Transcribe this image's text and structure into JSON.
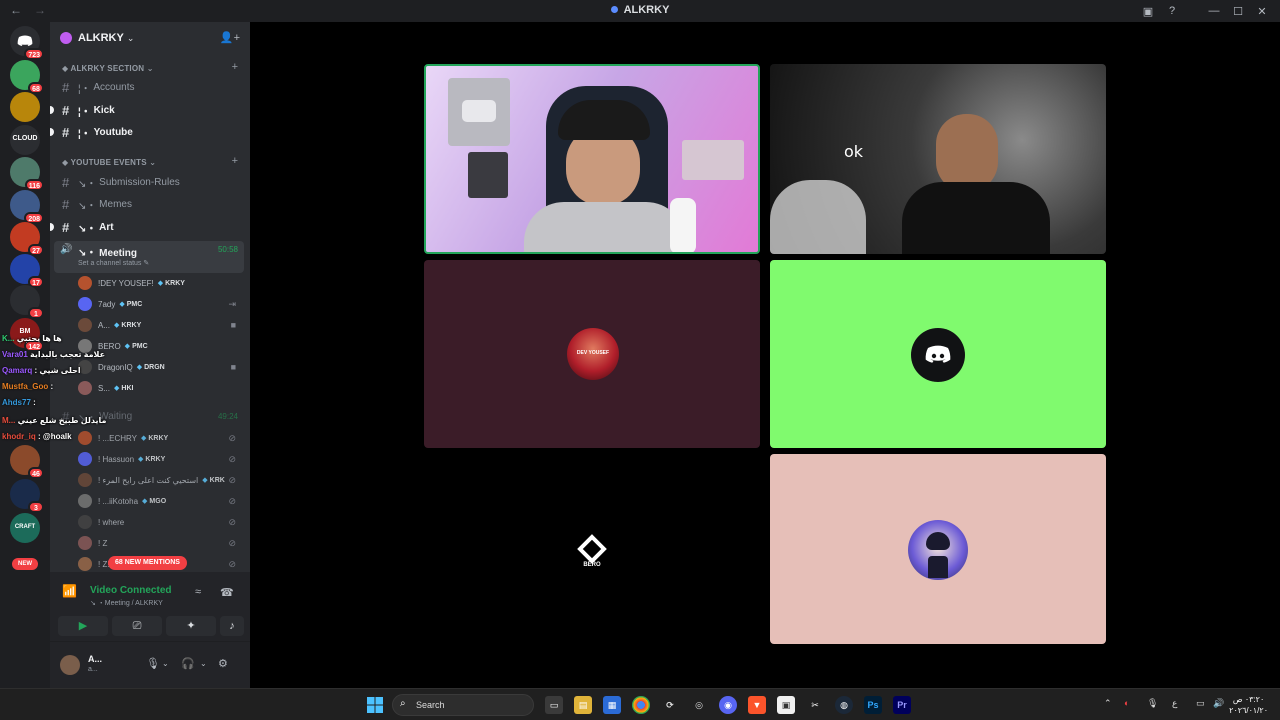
{
  "window": {
    "title": "ALKRKY",
    "back": "←",
    "forward": "→",
    "minimize": "—",
    "maximize": "☐",
    "close": "✕",
    "help": "?",
    "inbox": "▣"
  },
  "rail": {
    "home_badge": "723",
    "servers": [
      {
        "label": "",
        "badge": "68",
        "color": "#3ba55d"
      },
      {
        "label": "",
        "badge": "",
        "color": "#b8860b"
      },
      {
        "label": "CLOUD",
        "badge": "",
        "color": "#2b2d31"
      },
      {
        "label": "",
        "badge": "116",
        "color": "#4e7a6a"
      },
      {
        "label": "",
        "badge": "208",
        "color": "#3e5a8a"
      },
      {
        "label": "",
        "badge": "27",
        "color": "#c23b22"
      },
      {
        "label": "",
        "badge": "17",
        "color": "#2343a8"
      },
      {
        "label": "",
        "badge": "1",
        "color": "#2b2d31"
      },
      {
        "label": "BM",
        "badge": "142",
        "color": "#8a1a1a"
      }
    ],
    "servers_lower": [
      {
        "label": "",
        "badge": "46",
        "color": "#8b4a2b"
      },
      {
        "label": "",
        "badge": "3",
        "color": "#1a2b4a"
      },
      {
        "label": "CRAFT",
        "badge": "",
        "color": "#1c6b5a"
      }
    ],
    "new_label": "NEW"
  },
  "sidebar": {
    "server_name": "ALKRKY",
    "categories": [
      {
        "name": "ALKRKY SECTION"
      },
      {
        "name": "YOUTUBE EVENTS"
      }
    ],
    "channels": [
      {
        "name": "Accounts",
        "prefix": "¦・"
      },
      {
        "name": "Kick",
        "prefix": "¦・"
      },
      {
        "name": "Youtube",
        "prefix": "¦・"
      },
      {
        "name": "Submission-Rules",
        "prefix": "↘・"
      },
      {
        "name": "Memes",
        "prefix": "↘・"
      },
      {
        "name": "Art",
        "prefix": "↘・"
      }
    ],
    "voice_channel": {
      "name": "Meeting",
      "prefix": "↘・",
      "timer": "50:58",
      "status": "Set a channel status ✎"
    },
    "voice_users": [
      {
        "name": "!DEY YOUSEF!",
        "tag": "KRKY",
        "state": ""
      },
      {
        "name": "7ady",
        "tag": "PMC",
        "state": "⇥"
      },
      {
        "name": "A...",
        "tag": "KRKY",
        "state": "■"
      },
      {
        "name": "BERO",
        "tag": "PMC",
        "state": ""
      },
      {
        "name": "DragonIQ",
        "tag": "DRGN",
        "state": "■"
      },
      {
        "name": "S...",
        "tag": "HKI",
        "state": ""
      }
    ],
    "waiting_channel": {
      "name": "Waiting",
      "prefix": "↘・",
      "timer": "49:24"
    },
    "waiting_users": [
      {
        "name": "! ...ECHRY",
        "tag": "KRKY",
        "state": "⊘"
      },
      {
        "name": "! Hassuon",
        "tag": "KRKY",
        "state": "⊘"
      },
      {
        "name": "! استحيي كنت اعلى رايح المرء",
        "tag": "KRK",
        "state": "⊘"
      },
      {
        "name": "! ...iiKotoha",
        "tag": "MGO",
        "state": "⊘"
      },
      {
        "name": "! where",
        "tag": "",
        "state": "⊘"
      },
      {
        "name": "! Z",
        "tag": "",
        "state": "⊘"
      },
      {
        "name": "! Z!",
        "tag": "",
        "state": "⊘"
      }
    ],
    "mentions_label": "68 NEW MENTIONS"
  },
  "voice_panel": {
    "title": "Video Connected",
    "subtitle": "↘ ・Meeting / ALKRKY",
    "buttons": [
      "camera",
      "screen-share",
      "activities",
      "soundboard"
    ]
  },
  "user_panel": {
    "name": "A...",
    "status": "a..."
  },
  "chat_overlay": [
    {
      "user": "K...",
      "text": "ها ها يحتبي",
      "user_color": "#2ecc71"
    },
    {
      "user": "Vara01",
      "text": "علامة تعجب بالبداية",
      "user_color": "#9b59ff"
    },
    {
      "user": "Qamarq",
      "text": ": احلى شيي",
      "user_color": "#9b59ff"
    },
    {
      "user": "Mustfa_Goo",
      "text": ":",
      "user_color": "#e67e22"
    },
    {
      "user": "Ahds77",
      "text": ":",
      "user_color": "#3498db"
    },
    {
      "user": "M...",
      "text": "مايدلل طبيخ شلع عيني",
      "user_color": "#e74c3c"
    },
    {
      "user": "khodr_iq",
      "text": ": @hoalk",
      "user_color": "#e74c3c"
    }
  ],
  "stage": {
    "tiles": [
      {
        "name": "tile-1",
        "label": "",
        "bg": "#c7a6e6",
        "speaking": true
      },
      {
        "name": "tile-2",
        "label": "ok",
        "bg": "#3b3b3b",
        "speaking": false
      },
      {
        "name": "tile-3",
        "label": "",
        "bg": "#3b1c28",
        "speaking": false
      },
      {
        "name": "tile-4",
        "label": "",
        "bg": "#80fa6e",
        "speaking": false
      },
      {
        "name": "tile-5",
        "label": "BERO",
        "bg": "#000000",
        "speaking": false
      },
      {
        "name": "tile-6",
        "label": "",
        "bg": "#e6bfb8",
        "speaking": false
      }
    ],
    "tile3_avatar": "DEV YOUSEF"
  },
  "taskbar": {
    "search_placeholder": "Search",
    "apps": [
      "start",
      "search",
      "task-view",
      "file-explorer",
      "store",
      "chrome",
      "steam-alt",
      "settings",
      "discord",
      "brave",
      "notes",
      "capcut",
      "steam",
      "Ps",
      "Pr"
    ],
    "tray_lang": "ع",
    "time": "٠٣:٢٠ ص",
    "date": "٢٠٢٦/٠١/٢٠"
  },
  "colors": {
    "green": "#23a55a",
    "red": "#f23f43",
    "blurple": "#5865f2"
  }
}
